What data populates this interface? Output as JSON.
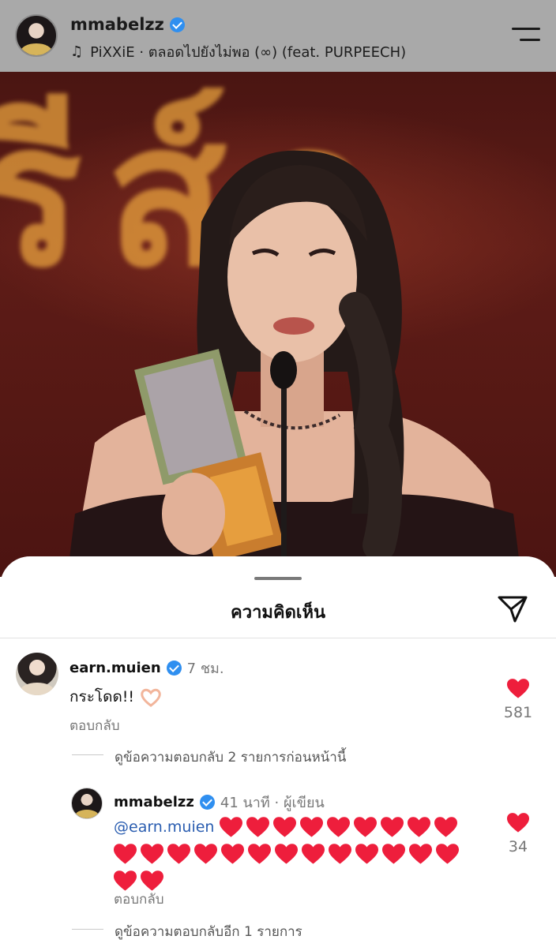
{
  "post": {
    "username": "mmabelzz",
    "music": "PiXXiE · ตลอดไปยังไม่พอ (∞) (feat. PURPEECH)",
    "header_bg": "#a9a9a9"
  },
  "sheet": {
    "title": "ความคิดเห็น"
  },
  "comments": [
    {
      "username": "earn.muien",
      "time": "7 ชม.",
      "text": "กระโดด!!",
      "reply_label": "ตอบกลับ",
      "likes": "581",
      "view_replies": "ดูข้อความตอบกลับ 2 รายการก่อนหน้านี้"
    },
    {
      "username": "mmabelzz",
      "time": "41 นาที · ผู้เขียน",
      "mention": "@earn.muien",
      "heart_count": 24,
      "reply_label": "ตอบกลับ",
      "likes": "34",
      "view_replies": "ดูข้อความตอบกลับอีก 1 รายการ"
    }
  ],
  "colors": {
    "verified": "#2f8ff0",
    "heart": "#ee1e3c",
    "mention": "#2a5db0"
  },
  "icons": {
    "music": "music-note-icon",
    "menu": "menu-icon",
    "share": "send-icon",
    "like": "heart-icon",
    "verified": "verified-badge-icon"
  }
}
